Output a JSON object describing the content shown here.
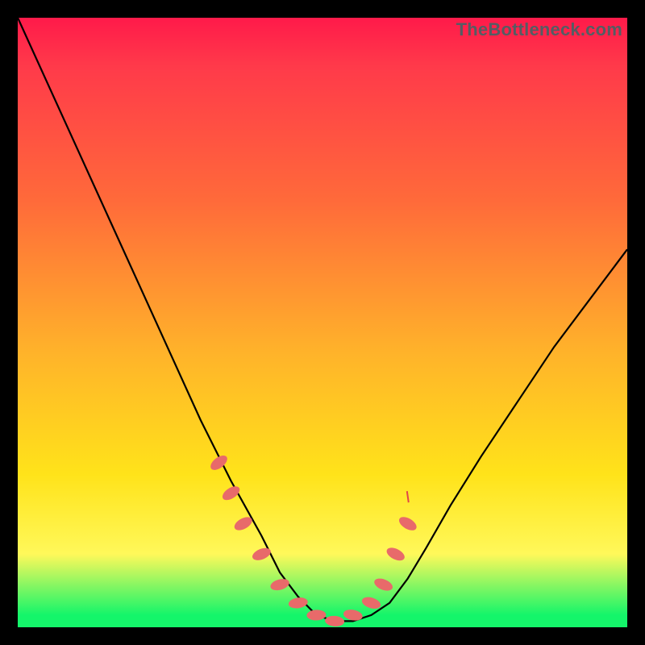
{
  "watermark": "TheBottleneck.com",
  "chart_data": {
    "type": "line",
    "title": "",
    "xlabel": "",
    "ylabel": "",
    "xlim": [
      0,
      100
    ],
    "ylim": [
      0,
      100
    ],
    "series": [
      {
        "name": "bottleneck-curve",
        "x": [
          0,
          5,
          10,
          15,
          20,
          25,
          30,
          35,
          40,
          43,
          46,
          49,
          52,
          55,
          58,
          61,
          64,
          67,
          71,
          76,
          82,
          88,
          94,
          100
        ],
        "y": [
          100,
          89,
          78,
          67,
          56,
          45,
          34,
          24,
          15,
          9,
          5,
          2,
          1,
          1,
          2,
          4,
          8,
          13,
          20,
          28,
          37,
          46,
          54,
          62
        ]
      }
    ],
    "markers": {
      "name": "highlight-dots",
      "x": [
        33,
        35,
        37,
        40,
        43,
        46,
        49,
        52,
        55,
        58,
        60,
        62,
        64
      ],
      "y": [
        27,
        22,
        17,
        12,
        7,
        4,
        2,
        1,
        2,
        4,
        7,
        12,
        17
      ]
    },
    "annotation_tick": {
      "x": 64,
      "y": 21
    },
    "gradient_stops": [
      {
        "pos": 0,
        "color": "#ff1a4a"
      },
      {
        "pos": 30,
        "color": "#ff6a3a"
      },
      {
        "pos": 55,
        "color": "#ffb32a"
      },
      {
        "pos": 75,
        "color": "#ffe31a"
      },
      {
        "pos": 98,
        "color": "#14f56a"
      }
    ]
  }
}
